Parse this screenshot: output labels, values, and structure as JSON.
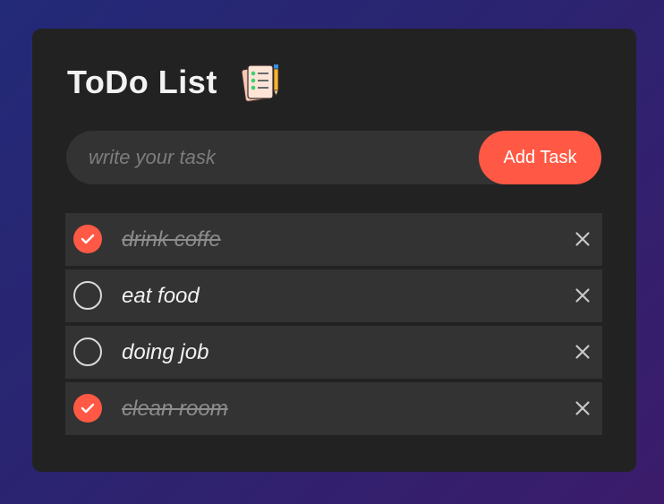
{
  "app": {
    "title": "ToDo List",
    "title_icon": "checklist-notepad-pencil-icon"
  },
  "input": {
    "placeholder": "write your task",
    "value": ""
  },
  "add_button": {
    "label": "Add Task"
  },
  "colors": {
    "accent": "#ff5945",
    "card_background": "#222222",
    "row_background": "#333333",
    "page_gradient_start": "#232a78",
    "page_gradient_end": "#3b1c6b"
  },
  "tasks": [
    {
      "text": "drink coffe",
      "done": true
    },
    {
      "text": "eat food",
      "done": false
    },
    {
      "text": "doing job",
      "done": false
    },
    {
      "text": "clean room",
      "done": true
    }
  ],
  "icons": {
    "checked": "check-icon",
    "unchecked": "empty-circle",
    "delete": "close-icon"
  }
}
